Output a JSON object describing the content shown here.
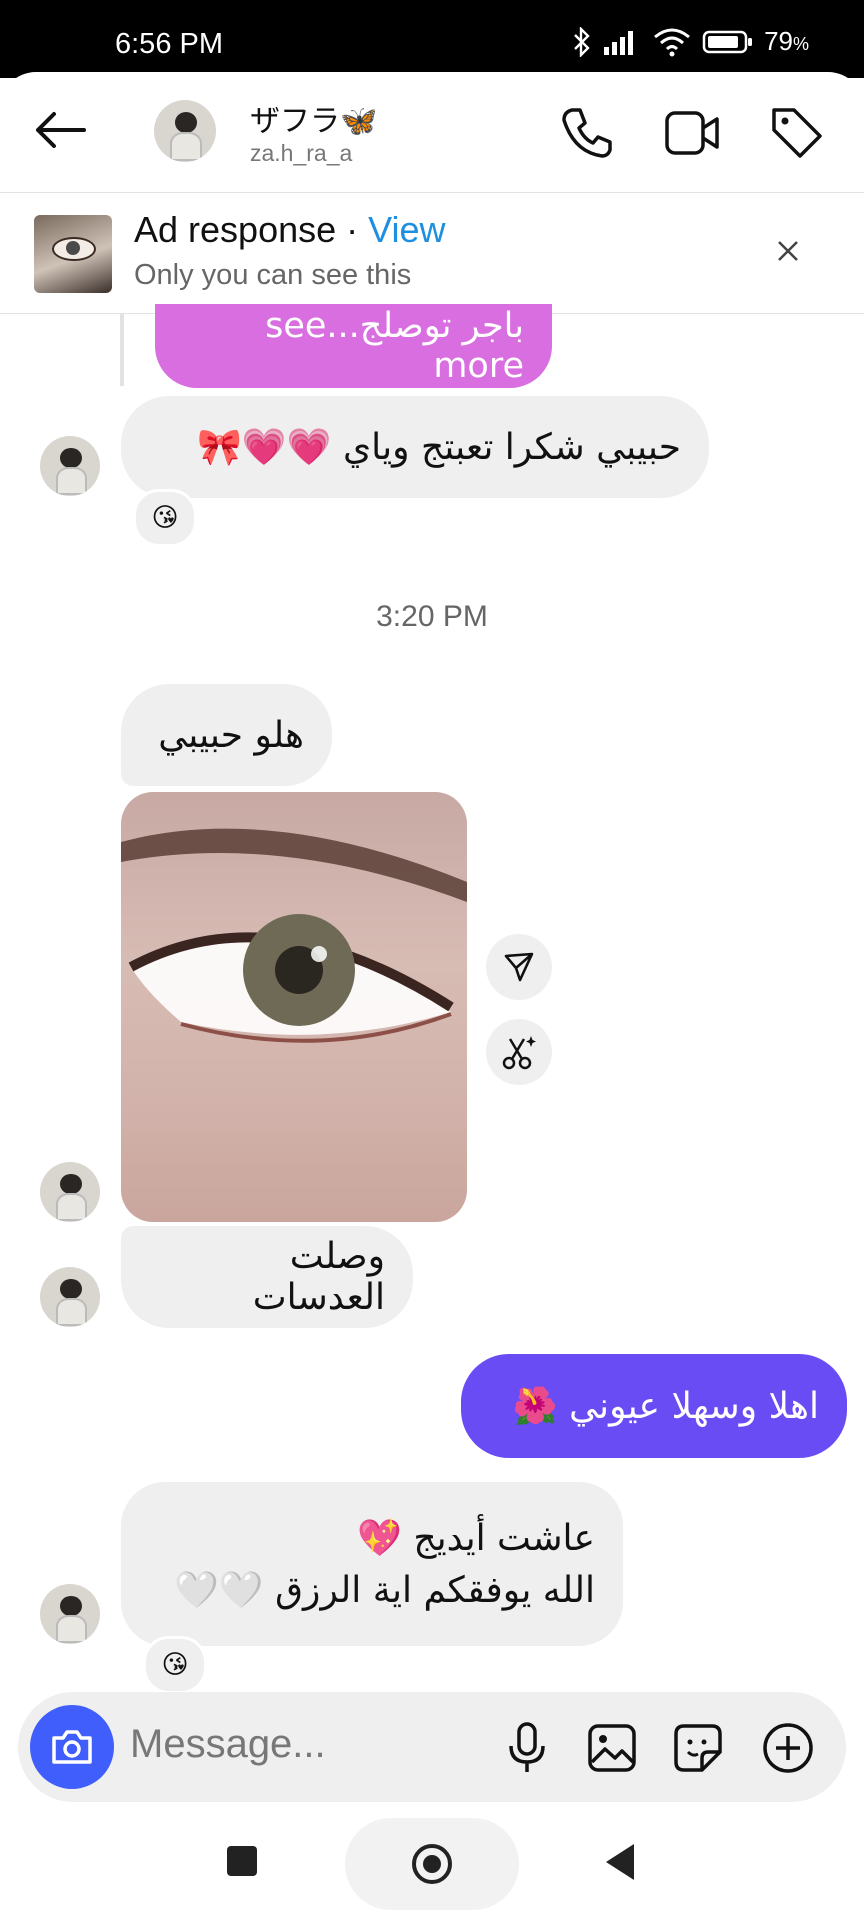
{
  "status_bar": {
    "time": "6:56 PM",
    "battery": "79"
  },
  "header": {
    "name": "ザフラ🦋",
    "handle": "za.h_ra_a"
  },
  "ad_banner": {
    "title": "Ad response",
    "separator": "·",
    "link": "View",
    "subtitle": "Only you can see this"
  },
  "messages": {
    "reply_preview": "باجر توصلج...see more",
    "m1": "حبيبي شكرا تعبتج وياي 💗💗🎀",
    "m1_reaction": "😘",
    "time_divider": "3:20 PM",
    "m2": "هلو حبيبي",
    "m3": "وصلت العدسات",
    "m4": "اهلا وسهلا عيوني 🌺",
    "m5_line1": "عاشت أيديج 💖",
    "m5_line2": "الله يوفقكم اية الرزق 🤍🤍",
    "m5_reaction": "😘"
  },
  "composer": {
    "placeholder": "Message..."
  },
  "colors": {
    "accent": "#3f5efb",
    "sent_bubble": "#6a4cf5",
    "reply_bubble": "#d86ee0",
    "link": "#1d8fe0"
  },
  "icons": [
    "back-arrow-icon",
    "phone-icon",
    "video-icon",
    "tag-icon",
    "close-icon",
    "share-icon",
    "ai-edit-icon",
    "camera-icon",
    "microphone-icon",
    "gallery-icon",
    "sticker-icon",
    "plus-icon",
    "recents-icon",
    "home-icon",
    "back-nav-icon"
  ]
}
